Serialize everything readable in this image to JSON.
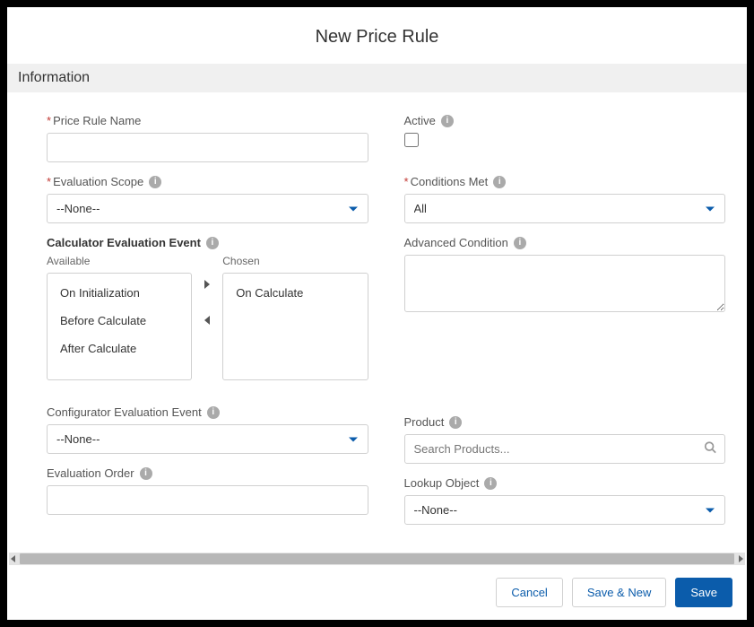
{
  "header": {
    "title": "New Price Rule"
  },
  "section": {
    "name": "Information"
  },
  "left": {
    "price_rule_name": {
      "label": "Price Rule Name",
      "value": ""
    },
    "evaluation_scope": {
      "label": "Evaluation Scope",
      "selected": "--None--"
    },
    "calc_event": {
      "label": "Calculator Evaluation Event",
      "available_caption": "Available",
      "chosen_caption": "Chosen",
      "available": [
        "On Initialization",
        "Before Calculate",
        "After Calculate"
      ],
      "chosen": [
        "On Calculate"
      ]
    },
    "config_event": {
      "label": "Configurator Evaluation Event",
      "selected": "--None--"
    },
    "eval_order": {
      "label": "Evaluation Order",
      "value": ""
    }
  },
  "right": {
    "active": {
      "label": "Active",
      "checked": false
    },
    "conditions_met": {
      "label": "Conditions Met",
      "selected": "All"
    },
    "advanced_condition": {
      "label": "Advanced Condition",
      "value": ""
    },
    "product": {
      "label": "Product",
      "placeholder": "Search Products..."
    },
    "lookup_object": {
      "label": "Lookup Object",
      "selected": "--None--"
    }
  },
  "footer": {
    "cancel": "Cancel",
    "save_new": "Save & New",
    "save": "Save"
  }
}
